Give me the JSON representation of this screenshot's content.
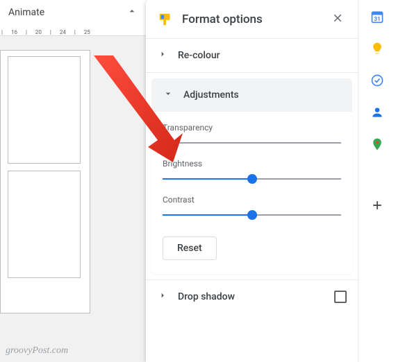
{
  "toolbar": {
    "animate": "Animate"
  },
  "ruler": {
    "ticks": [
      "",
      "16",
      "",
      "20",
      "",
      "24",
      "",
      "25"
    ]
  },
  "formatPanel": {
    "title": "Format options",
    "sections": {
      "recolour": {
        "title": "Re-colour"
      },
      "adjustments": {
        "title": "Adjustments",
        "transparency": {
          "label": "Transparency",
          "value": 0
        },
        "brightness": {
          "label": "Brightness",
          "value": 50
        },
        "contrast": {
          "label": "Contrast",
          "value": 50
        },
        "reset": "Reset"
      },
      "dropShadow": {
        "title": "Drop shadow",
        "checked": false
      }
    }
  },
  "watermark": "groovyPost.com"
}
